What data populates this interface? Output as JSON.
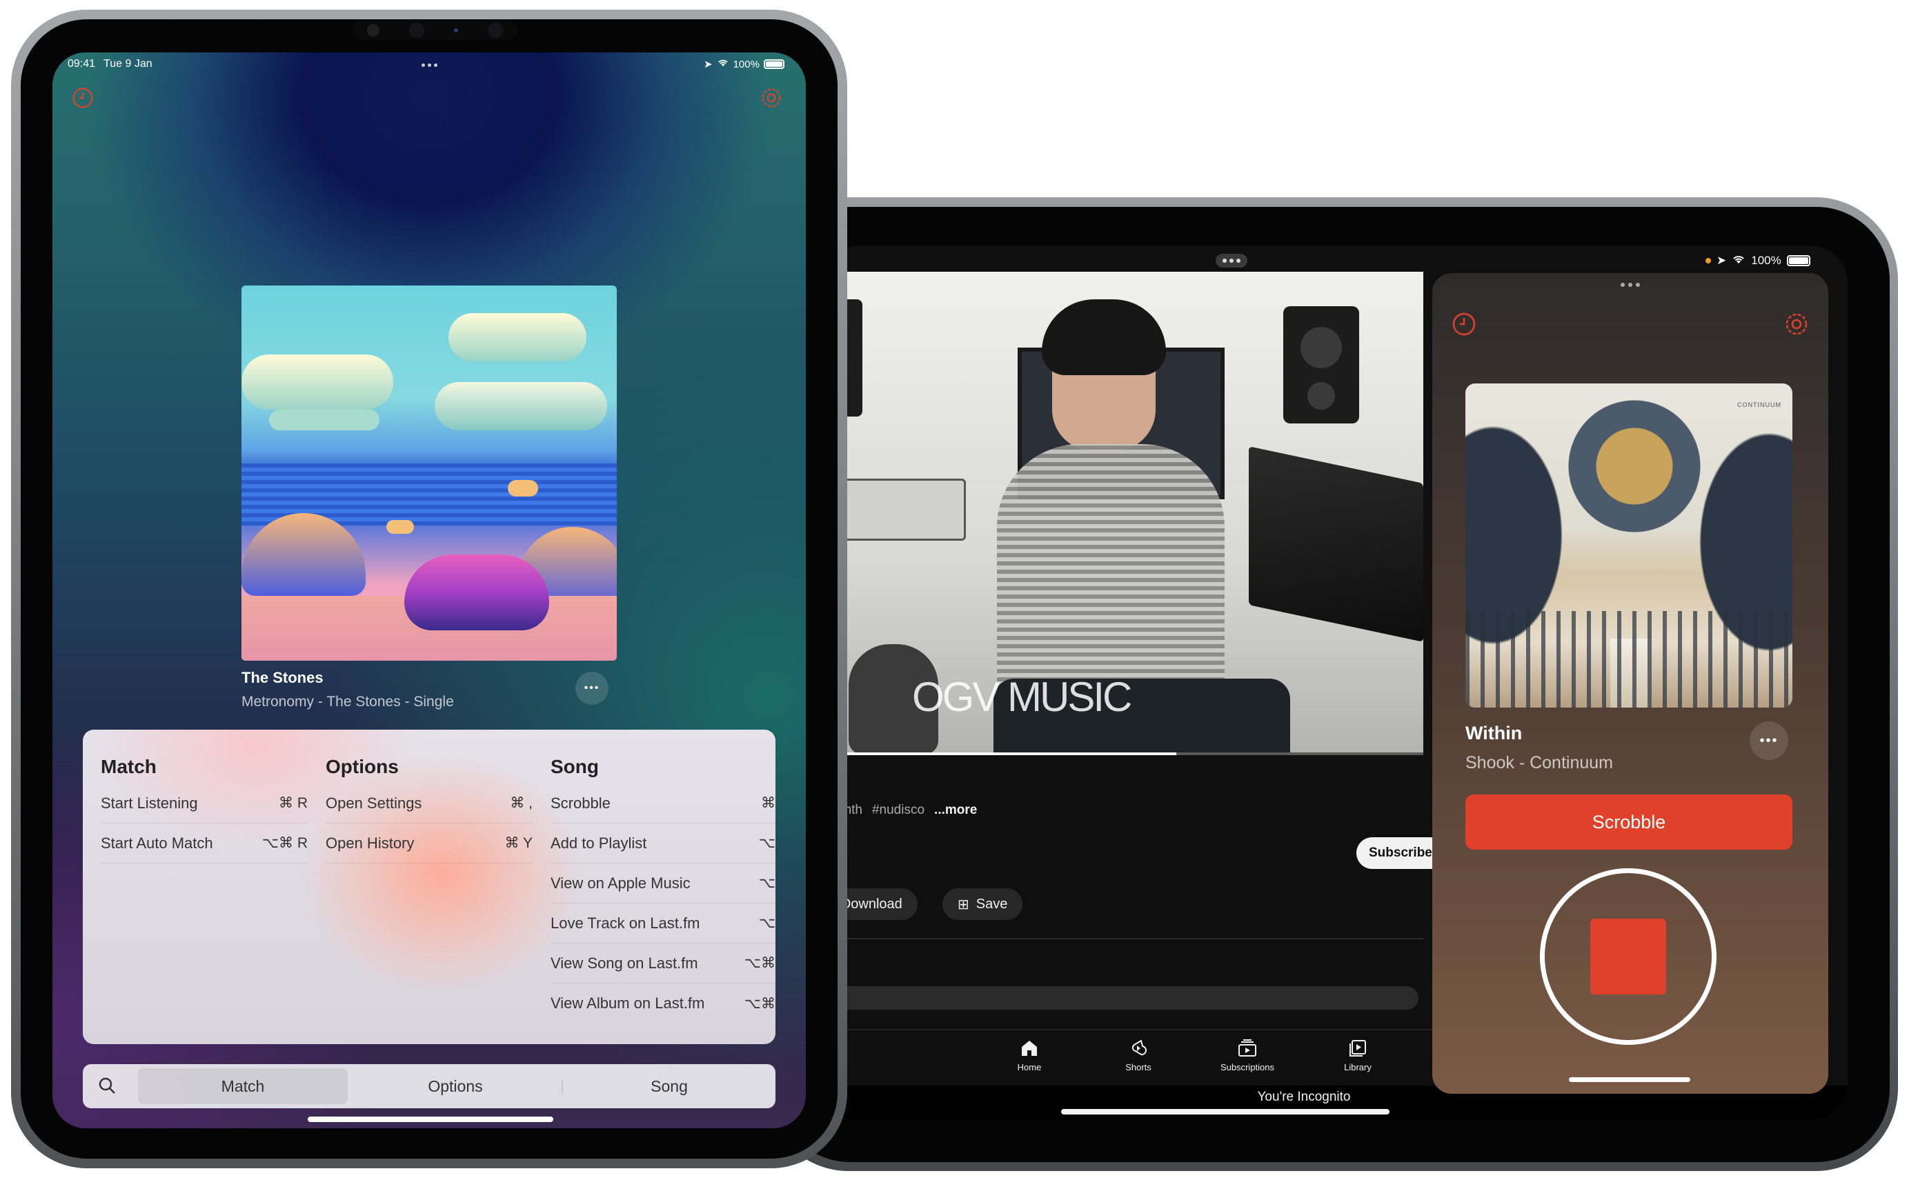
{
  "left_ipad": {
    "status": {
      "time": "09:41",
      "date": "Tue 9 Jan",
      "battery": "100%"
    },
    "top_bar": {
      "history_icon": "clock-icon",
      "settings_icon": "gear-icon"
    },
    "now_playing": {
      "title": "The Stones",
      "subtitle": "Metronomy - The Stones - Single",
      "more_label": "•••"
    },
    "commands": {
      "columns": [
        {
          "title": "Match",
          "items": [
            {
              "label": "Start Listening",
              "shortcut": "⌘ R"
            },
            {
              "label": "Start Auto Match",
              "shortcut": "⌥⌘ R"
            }
          ]
        },
        {
          "title": "Options",
          "items": [
            {
              "label": "Open Settings",
              "shortcut": "⌘ ,"
            },
            {
              "label": "Open History",
              "shortcut": "⌘ Y"
            }
          ]
        },
        {
          "title": "Song",
          "items": [
            {
              "label": "Scrobble",
              "shortcut": "⌘"
            },
            {
              "label": "Add to Playlist",
              "shortcut": "⌥"
            },
            {
              "label": "View on Apple Music",
              "shortcut": "⌥"
            },
            {
              "label": "Love Track on Last.fm",
              "shortcut": "⌥"
            },
            {
              "label": "View Song on Last.fm",
              "shortcut": "⌥⌘"
            },
            {
              "label": "View Album on Last.fm",
              "shortcut": "⌥⌘"
            }
          ]
        }
      ]
    },
    "segmented": {
      "items": [
        "Match",
        "Options",
        "Song"
      ],
      "selected": "Match"
    }
  },
  "right_ipad": {
    "status": {
      "battery": "100%"
    },
    "youtube": {
      "watermark": "OGV MUSIC",
      "tags": [
        "#synth",
        "#nudisco"
      ],
      "more": "...more",
      "subscribe": "Subscribe",
      "download": "Download",
      "save": "Save",
      "tabs": [
        {
          "label": "Home",
          "icon": "home-icon"
        },
        {
          "label": "Shorts",
          "icon": "shorts-icon"
        },
        {
          "label": "Subscriptions",
          "icon": "subscriptions-icon"
        },
        {
          "label": "Library",
          "icon": "library-icon"
        }
      ],
      "incognito": "You're Incognito",
      "progress": 0.59
    },
    "slideover": {
      "art_text": "CONTINUUM",
      "title": "Within",
      "subtitle": "Shook - Continuum",
      "more_label": "•••",
      "scrobble": "Scrobble"
    }
  },
  "colors": {
    "accent": "#e0412a",
    "scrobble_button": "#e0412a"
  }
}
